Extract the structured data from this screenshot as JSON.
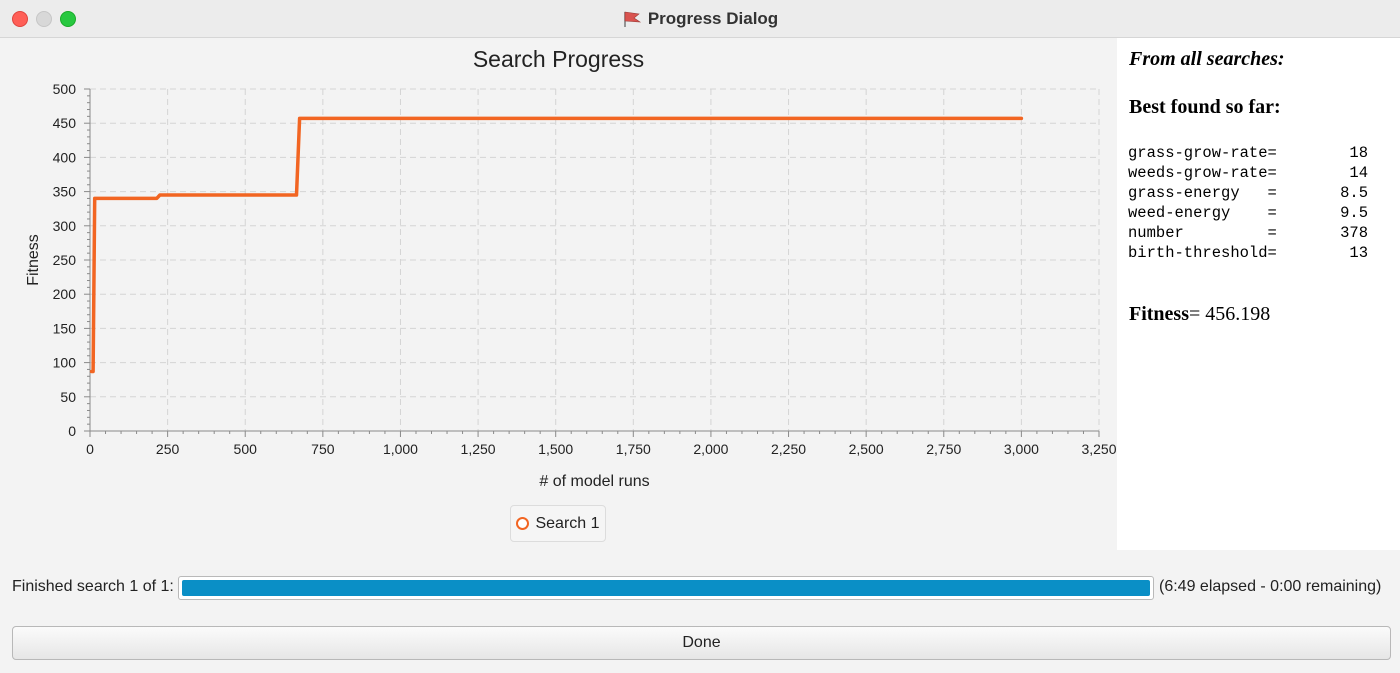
{
  "window": {
    "title": "Progress Dialog",
    "app_icon": "netlogo-flag-icon"
  },
  "chart_data": {
    "type": "line",
    "title": "Search Progress",
    "xlabel": "# of model runs",
    "ylabel": "Fitness",
    "xlim": [
      0,
      3250
    ],
    "ylim": [
      0,
      500
    ],
    "x_ticks": [
      0,
      250,
      500,
      750,
      1000,
      1250,
      1500,
      1750,
      2000,
      2250,
      2500,
      2750,
      3000,
      3250
    ],
    "x_tick_labels": [
      "0",
      "250",
      "500",
      "750",
      "1,000",
      "1,250",
      "1,500",
      "1,750",
      "2,000",
      "2,250",
      "2,500",
      "2,750",
      "3,000",
      "3,250"
    ],
    "y_ticks": [
      0,
      50,
      100,
      150,
      200,
      250,
      300,
      350,
      400,
      450,
      500
    ],
    "y_tick_labels": [
      "0",
      "50",
      "100",
      "150",
      "200",
      "250",
      "300",
      "350",
      "400",
      "450",
      "500"
    ],
    "grid": true,
    "legend_position": "bottom-center",
    "series": [
      {
        "name": "Search 1",
        "color": "#f26522",
        "x": [
          5,
          10,
          15,
          20,
          215,
          225,
          665,
          675,
          3000
        ],
        "y": [
          87,
          87,
          340,
          340,
          340,
          345,
          345,
          457,
          457
        ]
      }
    ]
  },
  "results": {
    "heading": "From all searches:",
    "best_label": "Best found so far:",
    "params": [
      {
        "name": "grass-grow-rate=",
        "value": "18"
      },
      {
        "name": "weeds-grow-rate=",
        "value": "14"
      },
      {
        "name": "grass-energy   =",
        "value": "8.5"
      },
      {
        "name": "weed-energy    =",
        "value": "9.5"
      },
      {
        "name": "number         =",
        "value": "378"
      },
      {
        "name": "birth-threshold=",
        "value": "13"
      }
    ],
    "fitness_label": "Fitness",
    "fitness_value": "= 456.198"
  },
  "status": {
    "label": "Finished search 1 of 1:",
    "progress": 1.0,
    "info": "(6:49 elapsed - 0:00 remaining)"
  },
  "buttons": {
    "done": "Done"
  }
}
